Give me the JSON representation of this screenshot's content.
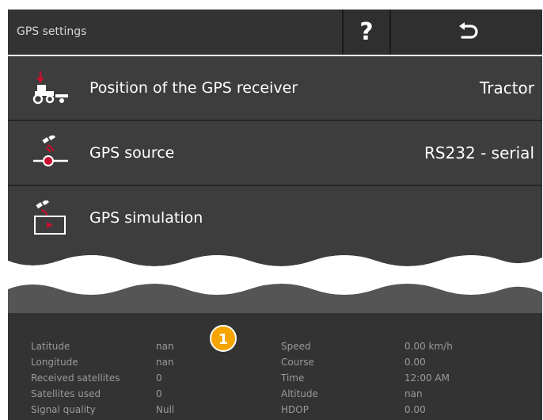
{
  "header": {
    "title": "GPS settings",
    "help_label": "?",
    "back_icon": "return-arrow-icon"
  },
  "rows": [
    {
      "label": "Position of the GPS receiver",
      "value": "Tractor",
      "icon": "tractor-receiver-icon"
    },
    {
      "label": "GPS source",
      "value": "RS232 - serial",
      "icon": "satellite-source-icon"
    },
    {
      "label": "GPS simulation",
      "value": "",
      "icon": "satellite-simulation-icon"
    }
  ],
  "marker": {
    "label": "1"
  },
  "info": {
    "col1_labels": [
      "Latitude",
      "Longitude",
      "Received satellites",
      "Satellites used",
      "Signal quality"
    ],
    "col1_values": [
      "nan",
      "nan",
      "0",
      "0",
      "Null"
    ],
    "col2_labels": [
      "Speed",
      "Course",
      "Time",
      "Altitude",
      "HDOP"
    ],
    "col2_values": [
      "0.00 km/h",
      "0.00",
      "12:00 AM",
      "nan",
      "0.00"
    ]
  },
  "colors": {
    "header_bg": "#333333",
    "row_bg": "#3d3d3d",
    "accent_red": "#c8102e",
    "marker": "#f5a400",
    "info_text": "#9a9a9a"
  }
}
